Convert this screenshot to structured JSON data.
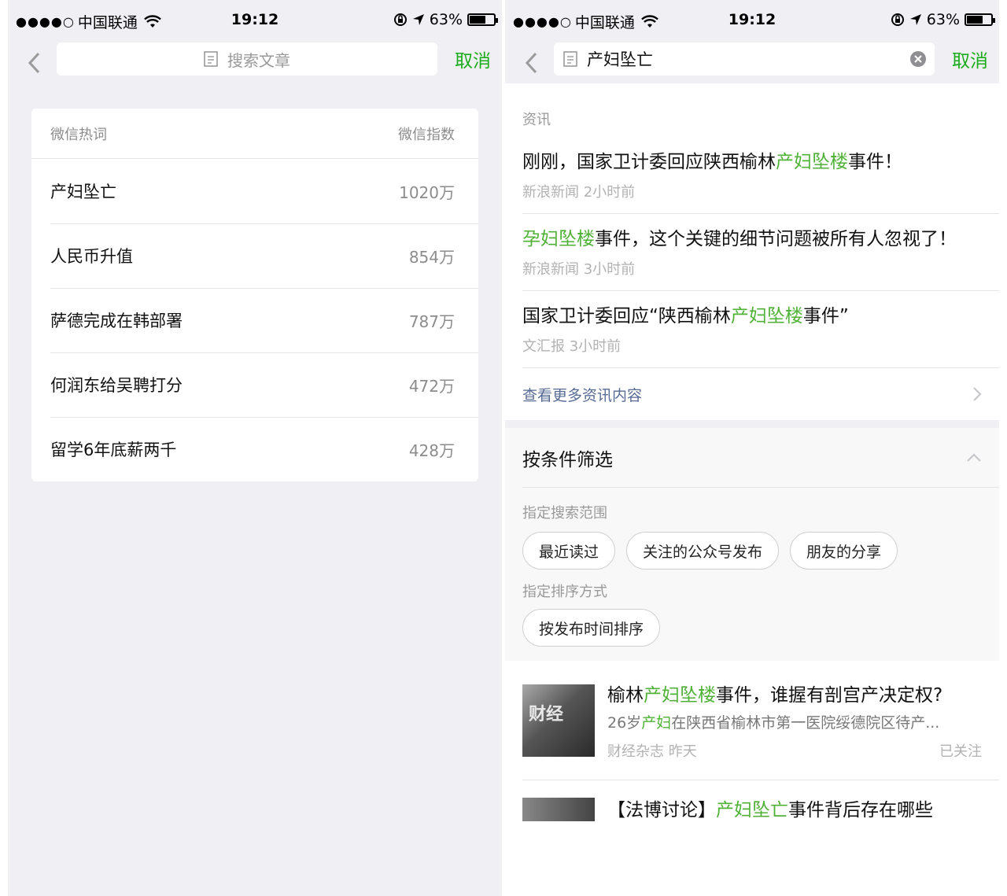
{
  "status_bar": {
    "signal_dots": "●●●●○",
    "carrier": "中国联通",
    "time": "19:12",
    "battery": "63%"
  },
  "left": {
    "search_placeholder": "搜索文章",
    "cancel": "取消",
    "hot": {
      "header_word": "微信热词",
      "header_index": "微信指数",
      "rows": [
        {
          "word": "产妇坠亡",
          "index": "1020万"
        },
        {
          "word": "人民币升值",
          "index": "854万"
        },
        {
          "word": "萨德完成在韩部署",
          "index": "787万"
        },
        {
          "word": "何润东给吴聘打分",
          "index": "472万"
        },
        {
          "word": "留学6年底薪两千",
          "index": "428万"
        }
      ]
    }
  },
  "right": {
    "search_value": "产妇坠亡",
    "cancel": "取消",
    "news_section": "资讯",
    "news": [
      {
        "pre": "刚刚，国家卫计委回应陕西榆林",
        "hl": "产妇坠楼",
        "post": "事件！",
        "meta": "新浪新闻 2小时前"
      },
      {
        "pre": "",
        "hl": "孕妇坠楼",
        "post": "事件，这个关键的细节问题被所有人忽视了！",
        "meta": "新浪新闻 3小时前"
      },
      {
        "pre": "国家卫计委回应“陕西榆林",
        "hl": "产妇坠楼",
        "post": "事件”",
        "meta": "文汇报 3小时前"
      }
    ],
    "more_news": "查看更多资讯内容",
    "filter": {
      "title": "按条件筛选",
      "scope_label": "指定搜索范围",
      "scope_chips": [
        "最近读过",
        "关注的公众号发布",
        "朋友的分享"
      ],
      "sort_label": "指定排序方式",
      "sort_chips": [
        "按发布时间排序"
      ]
    },
    "article": {
      "thumb_text": "财经",
      "title_pre": "榆林",
      "title_hl": "产妇坠楼",
      "title_post": "事件，谁握有剖宫产决定权?",
      "desc_pre": "26岁",
      "desc_hl": "产妇",
      "desc_post": "在陕西省榆林市第一医院绥德院区待产...",
      "source": "财经杂志 昨天",
      "followed": "已关注"
    },
    "article2": {
      "title_pre": "【法博讨论】",
      "title_hl": "产妇坠亡",
      "title_post": "事件背后存在哪些"
    }
  },
  "colors": {
    "accent_green": "#1aad19",
    "highlight_green": "#4fb236",
    "link_blue": "#576b95",
    "background_gray": "#efeff4"
  }
}
